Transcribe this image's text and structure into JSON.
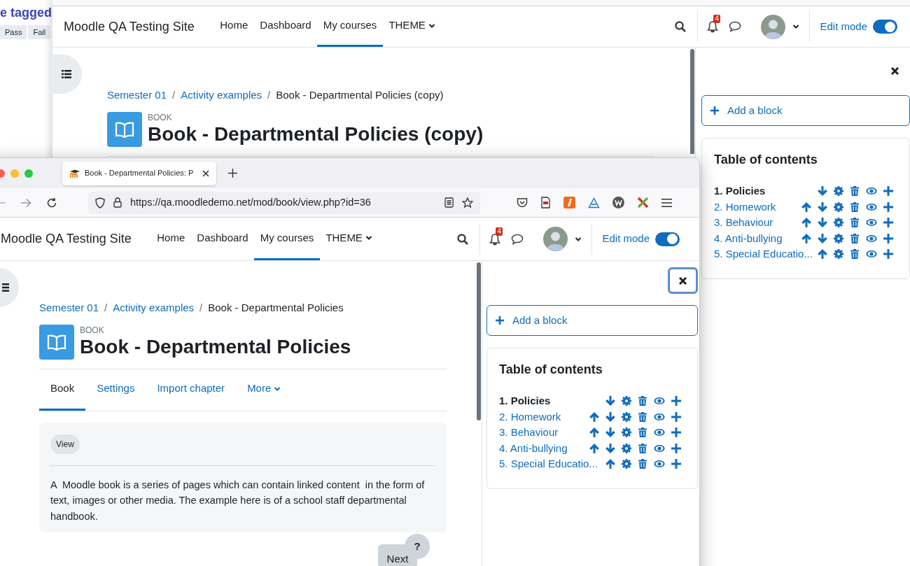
{
  "background_window": {
    "heading": "e tagged",
    "buttons": [
      "Pass",
      "Fail"
    ]
  },
  "back_window": {
    "site_name": "Moodle QA Testing Site",
    "nav": [
      {
        "label": "Home",
        "selected": false
      },
      {
        "label": "Dashboard",
        "selected": false
      },
      {
        "label": "My courses",
        "selected": true
      },
      {
        "label": "THEME",
        "selected": false,
        "dropdown": true
      }
    ],
    "notification_count": "4",
    "edit_mode": {
      "label": "Edit mode",
      "on": true
    },
    "breadcrumb": [
      "Semester 01",
      "Activity examples",
      "Book - Departmental Policies (copy)"
    ],
    "breadcrumb_separator": "/",
    "activity_type": "BOOK",
    "title": "Book - Departmental Policies (copy)",
    "drawer": {
      "add_block": "Add a block",
      "toc_title": "Table of contents",
      "chapters": [
        {
          "label": "1. Policies",
          "current": true,
          "can_move_up": false,
          "can_move_down": true
        },
        {
          "label": "2. Homework",
          "current": false,
          "can_move_up": true,
          "can_move_down": true
        },
        {
          "label": "3. Behaviour",
          "current": false,
          "can_move_up": true,
          "can_move_down": true
        },
        {
          "label": "4. Anti-bullying",
          "current": false,
          "can_move_up": true,
          "can_move_down": true
        },
        {
          "label": "5. Special Educatio...",
          "current": false,
          "can_move_up": true,
          "can_move_down": false
        }
      ]
    }
  },
  "front_window": {
    "tab_title": "Book - Departmental Policies: P",
    "url": "https://qa.moodledemo.net/mod/book/view.php?id=36",
    "site_name": "Moodle QA Testing Site",
    "nav": [
      {
        "label": "Home",
        "selected": false
      },
      {
        "label": "Dashboard",
        "selected": false
      },
      {
        "label": "My courses",
        "selected": true
      },
      {
        "label": "THEME",
        "selected": false,
        "dropdown": true
      }
    ],
    "notification_count": "4",
    "edit_mode": {
      "label": "Edit mode",
      "on": true
    },
    "breadcrumb": [
      "Semester 01",
      "Activity examples",
      "Book - Departmental Policies"
    ],
    "breadcrumb_separator": "/",
    "activity_type": "BOOK",
    "title": "Book - Departmental Policies",
    "secondary_nav": [
      {
        "label": "Book",
        "selected": true
      },
      {
        "label": "Settings",
        "selected": false
      },
      {
        "label": "Import chapter",
        "selected": false
      },
      {
        "label": "More",
        "selected": false,
        "dropdown": true
      }
    ],
    "view_badge": "View",
    "description": "A  Moodle book is a series of pages which can contain linked content  in the form of text, images or other media. The example here is of a school staff departmental handbook.",
    "help_button": "?",
    "next_button": "Next",
    "drawer": {
      "add_block": "Add a block",
      "toc_title": "Table of contents",
      "chapters": [
        {
          "label": "1. Policies",
          "current": true,
          "can_move_up": false,
          "can_move_down": true
        },
        {
          "label": "2. Homework",
          "current": false,
          "can_move_up": true,
          "can_move_down": true
        },
        {
          "label": "3. Behaviour",
          "current": false,
          "can_move_up": true,
          "can_move_down": true
        },
        {
          "label": "4. Anti-bullying",
          "current": false,
          "can_move_up": true,
          "can_move_down": true
        },
        {
          "label": "5. Special Educatio...",
          "current": false,
          "can_move_up": true,
          "can_move_down": false
        }
      ]
    }
  }
}
